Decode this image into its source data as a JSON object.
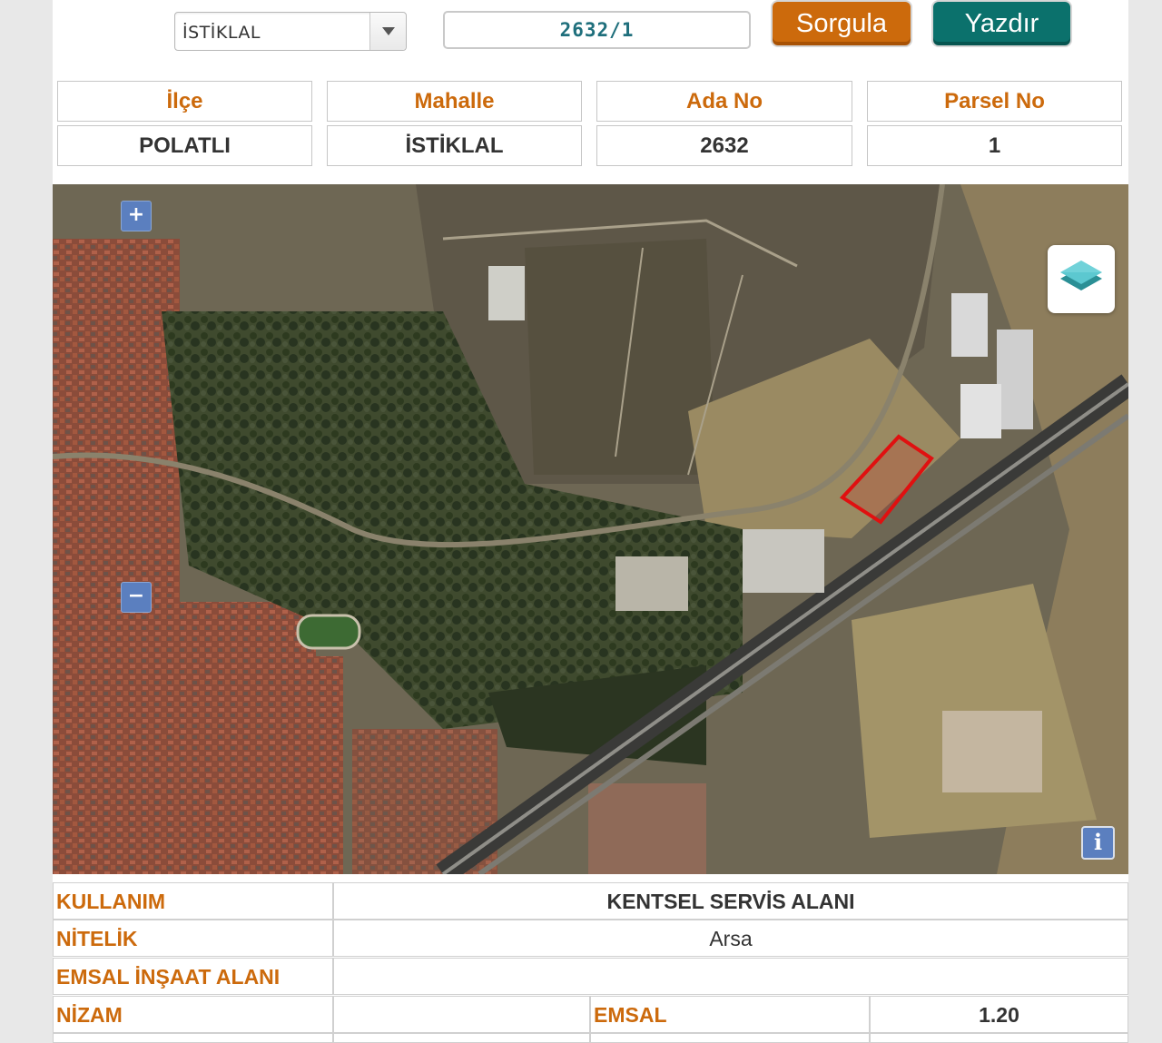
{
  "query": {
    "mahalle_select": "İSTİKLAL",
    "parcel_input": "2632/1",
    "sorgula_label": "Sorgula",
    "yazdir_label": "Yazdır"
  },
  "parcel_info": {
    "headers": [
      "İlçe",
      "Mahalle",
      "Ada No",
      "Parsel No"
    ],
    "values": [
      "POLATLI",
      "İSTİKLAL",
      "2632",
      "1"
    ]
  },
  "map": {
    "zoom_in": "+",
    "zoom_out": "−",
    "info": "i",
    "layers_icon": "layers-icon"
  },
  "attributes": {
    "kullanim_label": "KULLANIM",
    "kullanim_value": "KENTSEL SERVİS ALANI",
    "nitelik_label": "NİTELİK",
    "nitelik_value": "Arsa",
    "emsal_insaat_label": "EMSAL İNŞAAT ALANI",
    "emsal_insaat_value": "",
    "nizam_label": "NİZAM",
    "nizam_value": "",
    "emsal_label": "EMSAL",
    "emsal_value": "1.20"
  },
  "colors": {
    "accent_orange": "#cc6a0c",
    "accent_teal": "#0b716c",
    "parcel_outline": "#e01010"
  }
}
